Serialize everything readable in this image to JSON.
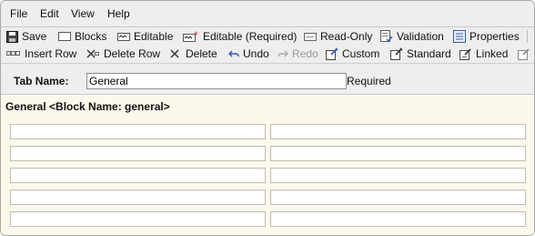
{
  "menu": [
    "File",
    "Edit",
    "View",
    "Help"
  ],
  "toolbar1": [
    {
      "label": "Save",
      "icon": "save-icon"
    },
    {
      "label": "Blocks",
      "icon": "blocks-icon"
    },
    {
      "label": "Editable",
      "icon": "editable-icon"
    },
    {
      "label": "Editable (Required)",
      "icon": "editable-required-icon"
    },
    {
      "label": "Read-Only",
      "icon": "read-only-icon"
    },
    {
      "label": "Validation",
      "icon": "validation-icon"
    },
    {
      "label": "Properties",
      "icon": "properties-icon"
    }
  ],
  "toolbar2": [
    {
      "label": "Insert Row",
      "icon": "insert-row-icon"
    },
    {
      "label": "Delete Row",
      "icon": "delete-row-icon"
    },
    {
      "label": "Delete",
      "icon": "delete-icon"
    },
    {
      "label": "Undo",
      "icon": "undo-icon"
    },
    {
      "label": "Redo",
      "icon": "redo-icon",
      "disabled": true
    },
    {
      "label": "Custom",
      "icon": "custom-icon"
    },
    {
      "label": "Standard",
      "icon": "standard-icon"
    },
    {
      "label": "Linked",
      "icon": "linked-icon"
    }
  ],
  "tab": {
    "label": "Tab Name:",
    "value": "General",
    "required": "Required"
  },
  "block": {
    "title": "General <Block Name: general>",
    "rows": 5,
    "columns": 2
  }
}
